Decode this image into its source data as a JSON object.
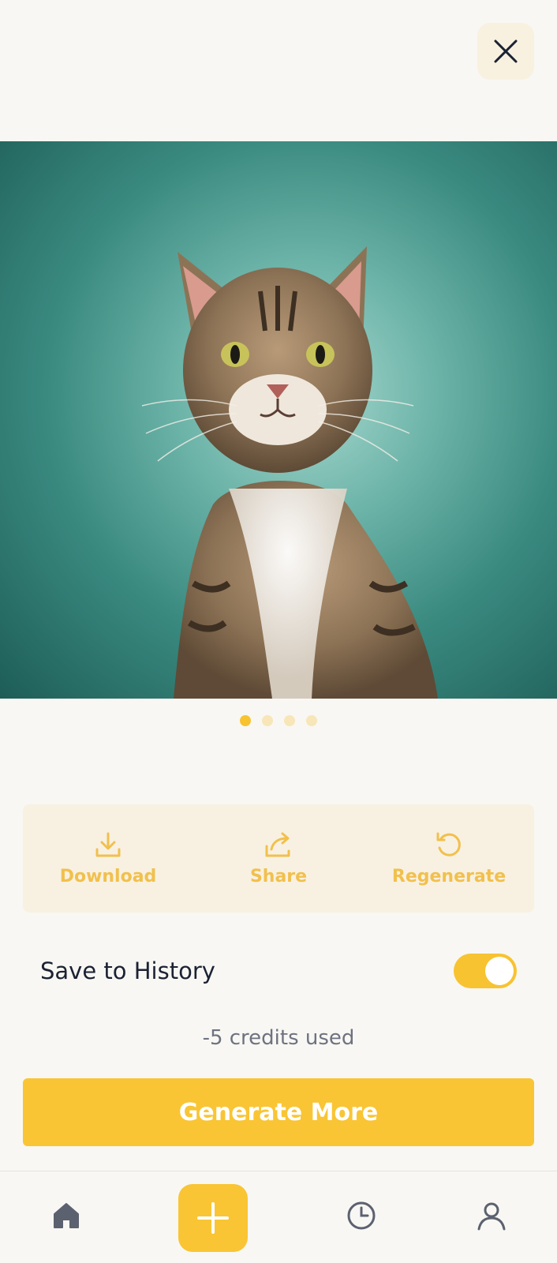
{
  "gallery": {
    "current_page": 1,
    "total_pages": 4
  },
  "actions": {
    "download_label": "Download",
    "share_label": "Share",
    "regenerate_label": "Regenerate"
  },
  "history": {
    "label": "Save to History",
    "enabled": true
  },
  "credits_text": "-5 credits used",
  "generate_label": "Generate More",
  "colors": {
    "accent": "#f9c534",
    "accent_text": "#f1c04d",
    "panel": "#f8f1e2",
    "background": "#f8f7f3",
    "nav_icon": "#5c6170"
  },
  "nav": {
    "items": [
      "home-icon",
      "plus-icon",
      "clock-icon",
      "user-icon"
    ]
  }
}
